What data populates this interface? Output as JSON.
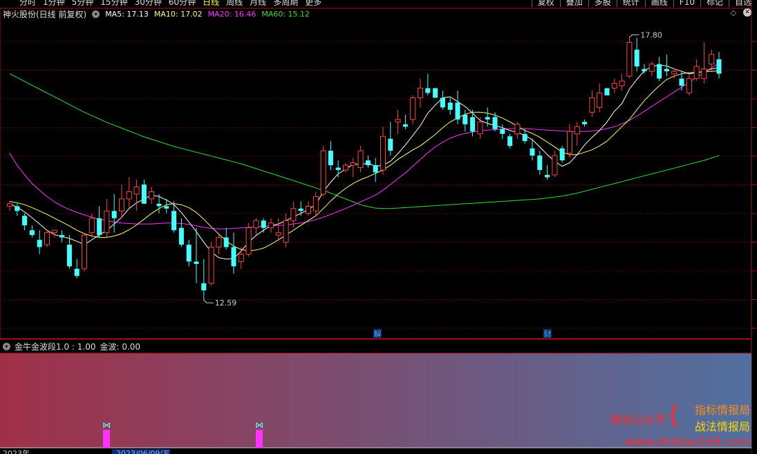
{
  "toolbar": {
    "period_tabs": [
      "分时",
      "1分钟",
      "5分钟",
      "15分钟",
      "30分钟",
      "60分钟",
      "日线",
      "周线",
      "月线",
      "多周期",
      "更多"
    ],
    "active_tab": "日线",
    "buttons": [
      "复权",
      "叠加",
      "多股",
      "统计",
      "画线",
      "F10",
      "标记",
      "自选"
    ]
  },
  "info": {
    "stock_name": "神火股份(日线 前复权)",
    "ma5": "MA5: 17.13",
    "ma10": "MA10: 17.02",
    "ma20": "MA20: 16.46",
    "ma60": "MA60: 15.12"
  },
  "colors": {
    "ma5": "#ffffff",
    "ma10": "#ffff66",
    "ma20": "#ff33ff",
    "ma60": "#33dd33",
    "up": "#ff4444",
    "down": "#44ffff",
    "frame": "#aa1111",
    "grid": "#660000",
    "ind_start": "#a03048",
    "ind_end": "#5070a0",
    "signal": "#ff33ff"
  },
  "price_labels": {
    "high": "17.80",
    "low": "12.59"
  },
  "event_markers": [
    "解",
    "财"
  ],
  "indicator": {
    "title": "金牛金波段1.0 : 1.00",
    "value": "金波: 0.00"
  },
  "date_axis": {
    "visible_date": "2023/06/09/五",
    "year_label": "2023年"
  },
  "watermark": {
    "wechat": "微信公众号",
    "item1": "指标情报局",
    "item2": "战法情报局",
    "url": "www.zhibiao168.com"
  },
  "chart_data": {
    "type": "candlestick",
    "price_range": [
      11.8,
      18.4
    ],
    "candles": [
      [
        14.55,
        14.65,
        14.45,
        14.6
      ],
      [
        14.55,
        14.6,
        14.35,
        14.45
      ],
      [
        14.35,
        14.4,
        14.05,
        14.15
      ],
      [
        14.05,
        14.15,
        13.9,
        13.95
      ],
      [
        13.85,
        14.05,
        13.55,
        13.7
      ],
      [
        13.75,
        14.05,
        13.7,
        14.0
      ],
      [
        14.0,
        14.05,
        13.9,
        14.05
      ],
      [
        13.95,
        14.05,
        13.8,
        13.9
      ],
      [
        13.75,
        13.95,
        13.25,
        13.3
      ],
      [
        13.25,
        13.45,
        13.05,
        13.1
      ],
      [
        13.25,
        14.0,
        13.2,
        13.95
      ],
      [
        14.0,
        14.4,
        13.9,
        14.3
      ],
      [
        14.3,
        14.55,
        13.9,
        13.95
      ],
      [
        14.0,
        14.7,
        13.9,
        14.45
      ],
      [
        14.45,
        14.8,
        14.0,
        14.3
      ],
      [
        14.45,
        15.0,
        14.3,
        14.7
      ],
      [
        14.7,
        15.15,
        14.5,
        14.85
      ],
      [
        14.8,
        15.1,
        14.45,
        14.95
      ],
      [
        15.0,
        15.1,
        14.6,
        14.6
      ],
      [
        14.7,
        14.95,
        14.6,
        14.85
      ],
      [
        14.6,
        14.8,
        14.4,
        14.55
      ],
      [
        14.55,
        14.7,
        14.4,
        14.5
      ],
      [
        14.45,
        14.65,
        14.0,
        14.05
      ],
      [
        14.1,
        14.3,
        13.7,
        13.75
      ],
      [
        13.75,
        13.85,
        13.3,
        13.4
      ],
      [
        13.4,
        14.1,
        12.95,
        13.35
      ],
      [
        12.95,
        13.45,
        12.6,
        12.8
      ],
      [
        12.95,
        13.8,
        12.9,
        13.7
      ],
      [
        13.7,
        14.0,
        13.55,
        13.9
      ],
      [
        13.9,
        14.1,
        13.65,
        13.7
      ],
      [
        13.7,
        14.0,
        13.15,
        13.3
      ],
      [
        13.4,
        13.7,
        13.25,
        13.55
      ],
      [
        13.55,
        14.2,
        13.5,
        14.1
      ],
      [
        14.1,
        14.3,
        13.95,
        14.25
      ],
      [
        14.25,
        14.3,
        14.0,
        14.1
      ],
      [
        14.1,
        14.3,
        14.0,
        14.2
      ],
      [
        13.95,
        14.3,
        13.85,
        14.0
      ],
      [
        13.8,
        14.4,
        13.7,
        14.25
      ],
      [
        14.25,
        14.65,
        14.1,
        14.5
      ],
      [
        14.5,
        14.65,
        14.35,
        14.45
      ],
      [
        14.4,
        14.65,
        14.35,
        14.55
      ],
      [
        14.45,
        14.85,
        14.35,
        14.75
      ],
      [
        14.8,
        15.8,
        14.75,
        15.7
      ],
      [
        15.7,
        15.9,
        15.3,
        15.4
      ],
      [
        15.35,
        15.5,
        15.15,
        15.3
      ],
      [
        15.3,
        15.45,
        15.25,
        15.4
      ],
      [
        15.4,
        15.55,
        15.15,
        15.45
      ],
      [
        15.35,
        15.8,
        15.25,
        15.7
      ],
      [
        15.5,
        15.6,
        15.35,
        15.4
      ],
      [
        15.4,
        15.55,
        15.05,
        15.25
      ],
      [
        15.3,
        16.2,
        15.2,
        16.0
      ],
      [
        15.95,
        16.3,
        15.6,
        15.7
      ],
      [
        16.3,
        16.55,
        16.05,
        16.35
      ],
      [
        16.25,
        16.45,
        16.15,
        16.2
      ],
      [
        16.35,
        16.85,
        16.25,
        16.8
      ],
      [
        16.8,
        17.2,
        16.6,
        17.0
      ],
      [
        17.0,
        17.3,
        16.85,
        16.9
      ],
      [
        17.0,
        17.0,
        16.8,
        16.8
      ],
      [
        16.8,
        16.95,
        16.55,
        16.6
      ],
      [
        16.7,
        16.8,
        16.45,
        16.55
      ],
      [
        16.7,
        16.95,
        16.25,
        16.35
      ],
      [
        16.45,
        16.55,
        16.1,
        16.25
      ],
      [
        16.4,
        16.55,
        16.0,
        16.1
      ],
      [
        16.05,
        16.4,
        15.95,
        16.3
      ],
      [
        16.4,
        16.6,
        16.2,
        16.35
      ],
      [
        16.4,
        16.5,
        16.1,
        16.15
      ],
      [
        16.15,
        16.25,
        15.95,
        16.05
      ],
      [
        16.0,
        16.05,
        15.75,
        15.8
      ],
      [
        16.05,
        16.3,
        15.95,
        16.25
      ],
      [
        16.05,
        16.15,
        15.85,
        15.9
      ],
      [
        15.75,
        15.95,
        15.5,
        15.6
      ],
      [
        15.6,
        15.7,
        15.2,
        15.3
      ],
      [
        15.2,
        15.4,
        15.1,
        15.15
      ],
      [
        15.2,
        15.7,
        15.15,
        15.6
      ],
      [
        15.75,
        15.8,
        15.45,
        15.5
      ],
      [
        15.65,
        16.25,
        15.55,
        16.1
      ],
      [
        16.05,
        16.3,
        15.8,
        16.2
      ],
      [
        16.3,
        16.35,
        16.2,
        16.25
      ],
      [
        16.5,
        16.95,
        16.4,
        16.8
      ],
      [
        16.6,
        17.1,
        16.5,
        16.9
      ],
      [
        17.0,
        17.0,
        16.85,
        16.85
      ],
      [
        17.0,
        17.2,
        16.9,
        17.1
      ],
      [
        17.05,
        17.3,
        16.95,
        17.15
      ],
      [
        17.25,
        18.05,
        17.2,
        17.95
      ],
      [
        17.8,
        18.05,
        17.35,
        17.45
      ],
      [
        17.4,
        17.5,
        17.3,
        17.35
      ],
      [
        17.35,
        17.55,
        17.25,
        17.5
      ],
      [
        17.5,
        17.65,
        17.15,
        17.2
      ],
      [
        17.4,
        17.7,
        17.25,
        17.35
      ],
      [
        17.3,
        17.4,
        17.2,
        17.35
      ],
      [
        17.2,
        17.35,
        16.95,
        17.05
      ],
      [
        16.9,
        17.3,
        16.85,
        17.2
      ],
      [
        17.2,
        17.6,
        17.15,
        17.45
      ],
      [
        17.2,
        17.95,
        17.1,
        17.4
      ],
      [
        17.5,
        17.8,
        17.35,
        17.7
      ],
      [
        17.6,
        17.75,
        17.2,
        17.3
      ]
    ],
    "ma5": [
      14.6,
      14.53,
      14.43,
      14.31,
      14.18,
      14.05,
      13.96,
      13.92,
      13.88,
      13.82,
      13.75,
      13.85,
      13.95,
      14.05,
      14.18,
      14.32,
      14.5,
      14.62,
      14.7,
      14.78,
      14.75,
      14.68,
      14.58,
      14.42,
      14.22,
      14.02,
      13.8,
      13.6,
      13.48,
      13.45,
      13.46,
      13.62,
      13.8,
      13.94,
      14.05,
      14.15,
      14.18,
      14.25,
      14.33,
      14.4,
      14.48,
      14.58,
      14.85,
      15.05,
      15.22,
      15.32,
      15.42,
      15.42,
      15.44,
      15.38,
      15.4,
      15.48,
      15.64,
      15.82,
      16.02,
      16.22,
      16.48,
      16.65,
      16.8,
      16.82,
      16.72,
      16.62,
      16.48,
      16.33,
      16.27,
      16.22,
      16.18,
      16.12,
      16.08,
      16.02,
      15.93,
      15.78,
      15.62,
      15.48,
      15.38,
      15.45,
      15.62,
      15.82,
      15.98,
      16.12,
      16.3,
      16.52,
      16.68,
      16.98,
      17.18,
      17.36,
      17.45,
      17.48,
      17.46,
      17.4,
      17.35,
      17.3,
      17.32,
      17.35,
      17.4,
      17.42
    ],
    "ma10": [
      14.65,
      14.62,
      14.58,
      14.52,
      14.45,
      14.38,
      14.3,
      14.22,
      14.14,
      14.05,
      13.98,
      13.93,
      13.9,
      13.9,
      13.93,
      13.98,
      14.06,
      14.16,
      14.28,
      14.4,
      14.5,
      14.58,
      14.6,
      14.58,
      14.52,
      14.42,
      14.28,
      14.12,
      13.97,
      13.83,
      13.72,
      13.65,
      13.62,
      13.64,
      13.68,
      13.76,
      13.85,
      13.95,
      14.05,
      14.15,
      14.25,
      14.35,
      14.5,
      14.66,
      14.8,
      14.92,
      15.02,
      15.1,
      15.16,
      15.23,
      15.3,
      15.4,
      15.52,
      15.62,
      15.72,
      15.8,
      15.92,
      16.04,
      16.18,
      16.3,
      16.38,
      16.46,
      16.5,
      16.5,
      16.48,
      16.44,
      16.38,
      16.3,
      16.21,
      16.12,
      16.06,
      15.98,
      15.88,
      15.78,
      15.67,
      15.62,
      15.62,
      15.67,
      15.72,
      15.8,
      15.9,
      16.05,
      16.2,
      16.35,
      16.55,
      16.74,
      16.9,
      17.05,
      17.18,
      17.25,
      17.3,
      17.32,
      17.33,
      17.34,
      17.35,
      17.36
    ],
    "ma20": [
      15.65,
      15.4,
      15.2,
      15.02,
      14.88,
      14.75,
      14.64,
      14.55,
      14.48,
      14.42,
      14.37,
      14.32,
      14.28,
      14.25,
      14.22,
      14.2,
      14.19,
      14.18,
      14.18,
      14.18,
      14.19,
      14.2,
      14.2,
      14.19,
      14.17,
      14.14,
      14.11,
      14.09,
      14.08,
      14.08,
      14.09,
      14.1,
      14.11,
      14.12,
      14.13,
      14.14,
      14.15,
      14.16,
      14.18,
      14.2,
      14.23,
      14.27,
      14.32,
      14.38,
      14.44,
      14.5,
      14.57,
      14.64,
      14.71,
      14.78,
      14.88,
      15.0,
      15.12,
      15.24,
      15.38,
      15.52,
      15.66,
      15.78,
      15.88,
      15.96,
      16.02,
      16.06,
      16.09,
      16.11,
      16.13,
      16.14,
      16.15,
      16.16,
      16.16,
      16.16,
      16.15,
      16.14,
      16.13,
      16.12,
      16.11,
      16.1,
      16.1,
      16.1,
      16.11,
      16.13,
      16.16,
      16.2,
      16.26,
      16.33,
      16.42,
      16.52,
      16.62,
      16.72,
      16.82,
      16.92,
      17.02,
      17.12,
      17.22,
      17.32,
      17.42,
      17.52
    ],
    "ma60": [
      17.3,
      17.22,
      17.14,
      17.06,
      16.98,
      16.9,
      16.82,
      16.74,
      16.66,
      16.58,
      16.5,
      16.43,
      16.36,
      16.29,
      16.23,
      16.17,
      16.11,
      16.05,
      15.99,
      15.94,
      15.89,
      15.84,
      15.79,
      15.75,
      15.71,
      15.67,
      15.63,
      15.59,
      15.55,
      15.51,
      15.47,
      15.43,
      15.38,
      15.33,
      15.28,
      15.23,
      15.18,
      15.13,
      15.08,
      15.03,
      14.98,
      14.93,
      14.88,
      14.82,
      14.76,
      14.7,
      14.64,
      14.58,
      14.54,
      14.51,
      14.5,
      14.5,
      14.51,
      14.52,
      14.53,
      14.54,
      14.55,
      14.56,
      14.57,
      14.58,
      14.59,
      14.6,
      14.61,
      14.62,
      14.63,
      14.64,
      14.65,
      14.66,
      14.67,
      14.68,
      14.69,
      14.7,
      14.72,
      14.74,
      14.76,
      14.79,
      14.82,
      14.86,
      14.9,
      14.94,
      14.98,
      15.02,
      15.06,
      15.1,
      15.14,
      15.18,
      15.22,
      15.26,
      15.3,
      15.34,
      15.38,
      15.42,
      15.46,
      15.5,
      15.55,
      15.6
    ],
    "signals_candle_index": [
      17,
      46
    ],
    "signal_value": 1.0
  }
}
